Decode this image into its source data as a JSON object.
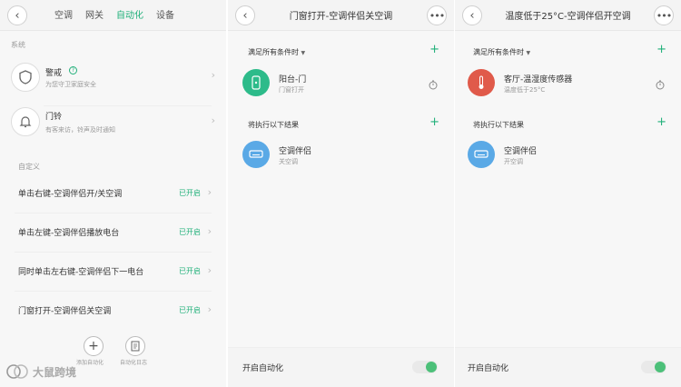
{
  "panel1": {
    "tabs": [
      "空调",
      "网关",
      "自动化",
      "设备"
    ],
    "system_label": "系统",
    "guard": {
      "title": "警戒",
      "subtitle": "为您守卫家庭安全"
    },
    "doorbell": {
      "title": "门铃",
      "subtitle": "有客来访，铃声及时通知"
    },
    "custom_label": "自定义",
    "rules": [
      {
        "label": "单击右键-空调伴侣开/关空调",
        "status": "已开启"
      },
      {
        "label": "单击左键-空调伴侣播放电台",
        "status": "已开启"
      },
      {
        "label": "同时单击左右键-空调伴侣下一电台",
        "status": "已开启"
      },
      {
        "label": "门窗打开-空调伴侣关空调",
        "status": "已开启"
      }
    ],
    "add_label": "添加自动化",
    "log_label": "自动化日志",
    "watermark": "大鼠跨境"
  },
  "panel2": {
    "title": "门窗打开-空调伴侣关空调",
    "conditions_label": "满足所有条件时",
    "condition": {
      "name": "阳台-门",
      "detail": "门窗打开"
    },
    "results_label": "将执行以下结果",
    "result": {
      "name": "空调伴侣",
      "detail": "关空调"
    },
    "enable_label": "开启自动化"
  },
  "panel3": {
    "title": "温度低于25°C-空调伴侣开空调",
    "conditions_label": "满足所有条件时",
    "condition": {
      "name": "客厅-温湿度传感器",
      "detail": "温度低于25°C"
    },
    "results_label": "将执行以下结果",
    "result": {
      "name": "空调伴侣",
      "detail": "开空调"
    },
    "enable_label": "开启自动化"
  },
  "colors": {
    "accent": "#21b07a",
    "door_icon": "#2dbb8a",
    "sensor_icon": "#e05a4a",
    "ac_icon": "#5aa9e6"
  }
}
